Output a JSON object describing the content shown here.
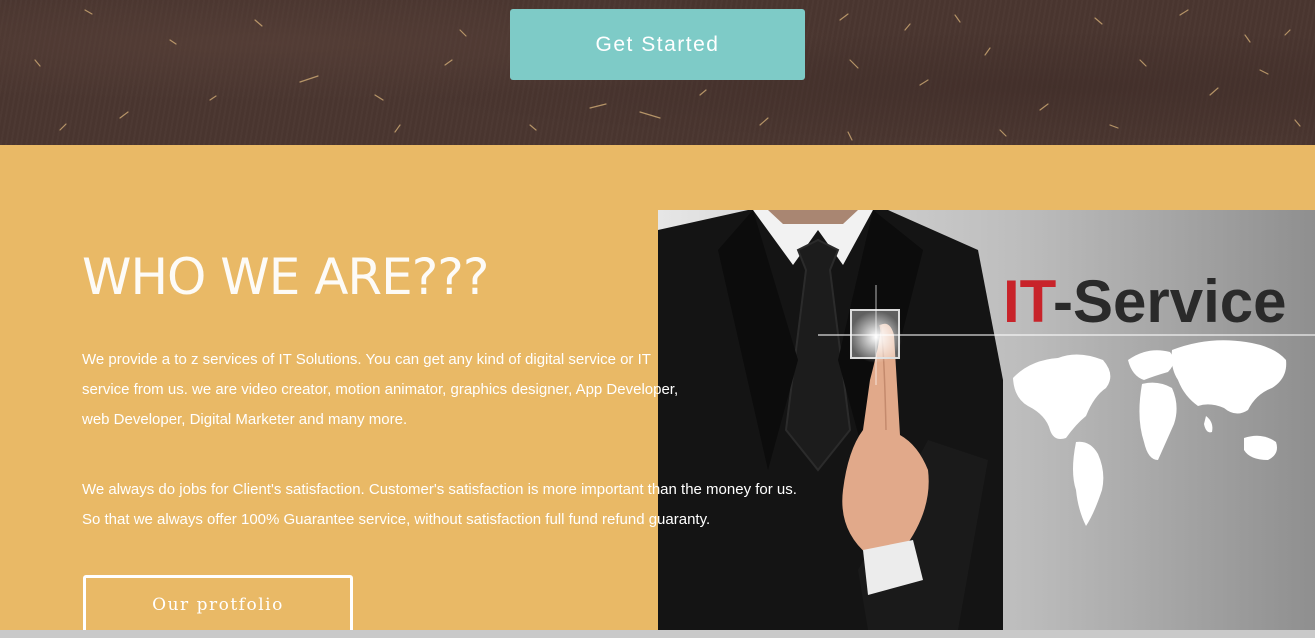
{
  "hero": {
    "cta_label": "Get Started",
    "background_color": "#4a3630",
    "button_color": "#7ecbc7"
  },
  "about": {
    "heading": "WHO WE ARE???",
    "paragraph_1": "We provide a to z services of IT Solutions. You can get any kind of digital service or IT service from us. we are video creator, motion animator, graphics designer, App Developer, web Developer, Digital Marketer and many more.",
    "paragraph_2": "We always do jobs for Client's satisfaction. Customer's satisfaction is more important than the money for us. So that we always offer 100% Guarantee service, without satisfaction full fund refund guaranty.",
    "button_label": "Our protfolio",
    "background_color": "#e9b966"
  },
  "image": {
    "title_prefix": "IT",
    "title_suffix": "-Service",
    "icon": "businessman-touch-world-map-image",
    "accent_color": "#c8232a"
  }
}
